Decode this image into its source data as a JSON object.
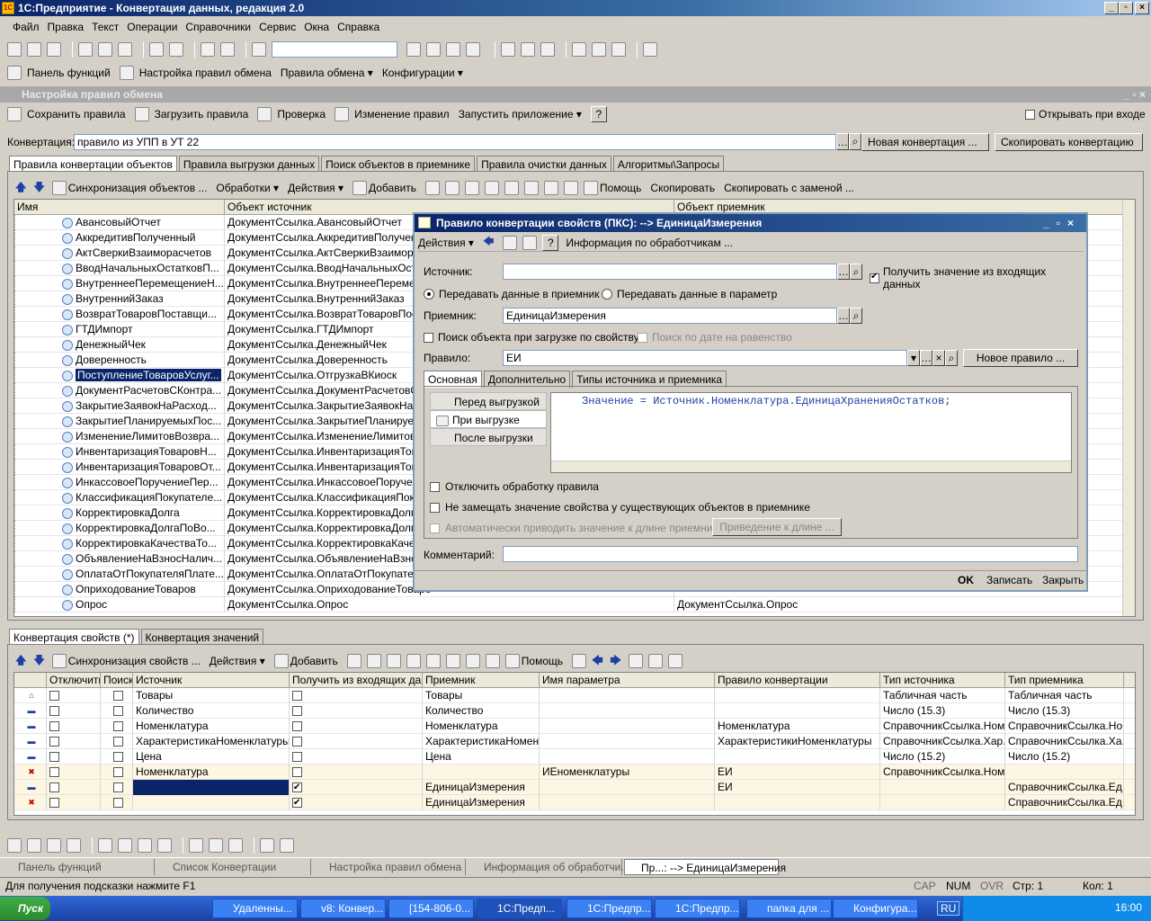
{
  "window": {
    "title": "1С:Предприятие - Конвертация данных, редакция 2.0"
  },
  "menu": [
    "Файл",
    "Правка",
    "Текст",
    "Операции",
    "Справочники",
    "Сервис",
    "Окна",
    "Справка"
  ],
  "panel_toolbar": {
    "functions": "Панель функций",
    "settings": "Настройка правил обмена",
    "rules": "Правила обмена",
    "configs": "Конфигурации"
  },
  "subwindow": {
    "title": "Настройка правил обмена"
  },
  "sub_toolbar": {
    "save": "Сохранить правила",
    "load": "Загрузить правила",
    "check": "Проверка",
    "change": "Изменение правил",
    "run": "Запустить приложение",
    "open_on_start": "Открывать при входе"
  },
  "conversion": {
    "label": "Конвертация:",
    "value": "правило из УПП в УТ 22",
    "new_btn": "Новая конвертация ...",
    "copy_btn": "Скопировать конвертацию"
  },
  "top_tabs": [
    "Правила конвертации объектов",
    "Правила выгрузки данных",
    "Поиск объектов в приемнике",
    "Правила очистки данных",
    "Алгоритмы\\Запросы"
  ],
  "obj_toolbar": {
    "sync": "Синхронизация объектов ...",
    "processing": "Обработки",
    "actions": "Действия",
    "add": "Добавить",
    "help": "Помощь",
    "copy": "Скопировать",
    "copy_replace": "Скопировать с заменой ..."
  },
  "obj_grid": {
    "headers": [
      "Имя",
      "Объект источник",
      "Объект приемник"
    ],
    "rows": [
      [
        "АвансовыйОтчет",
        "ДокументСсылка.АвансовыйОтчет",
        ""
      ],
      [
        "АккредитивПолученный",
        "ДокументСсылка.АккредитивПолученны",
        ""
      ],
      [
        "АктСверкиВзаиморасчетов",
        "ДокументСсылка.АктСверкиВзаиморас",
        ""
      ],
      [
        "ВводНачальныхОстатковП...",
        "ДокументСсылка.ВводНачальныхОстат",
        ""
      ],
      [
        "ВнутреннееПеремещениеН...",
        "ДокументСсылка.ВнутреннееПеремеще",
        ""
      ],
      [
        "ВнутреннийЗаказ",
        "ДокументСсылка.ВнутреннийЗаказ",
        ""
      ],
      [
        "ВозвратТоваровПоставщи...",
        "ДокументСсылка.ВозвратТоваровПоста",
        ""
      ],
      [
        "ГТДИмпорт",
        "ДокументСсылка.ГТДИмпорт",
        ""
      ],
      [
        "ДенежныйЧек",
        "ДокументСсылка.ДенежныйЧек",
        ""
      ],
      [
        "Доверенность",
        "ДокументСсылка.Доверенность",
        ""
      ],
      [
        "ПоступлениеТоваровУслуг...",
        "ДокументСсылка.ОтгрузкаВКиоск",
        ""
      ],
      [
        "ДокументРасчетовСКонтра...",
        "ДокументСсылка.ДокументРасчетовСК",
        ""
      ],
      [
        "ЗакрытиеЗаявокНаРасход...",
        "ДокументСсылка.ЗакрытиеЗаявокНаРа",
        ""
      ],
      [
        "ЗакрытиеПланируемыхПос...",
        "ДокументСсылка.ЗакрытиеПланируемь",
        ""
      ],
      [
        "ИзменениеЛимитовВозвра...",
        "ДокументСсылка.ИзменениеЛимитовВо",
        ""
      ],
      [
        "ИнвентаризацияТоваровН...",
        "ДокументСсылка.ИнвентаризацияТовар",
        ""
      ],
      [
        "ИнвентаризацияТоваровОт...",
        "ДокументСсылка.ИнвентаризацияТовар",
        ""
      ],
      [
        "ИнкассовоеПоручениеПер...",
        "ДокументСсылка.ИнкассовоеПоручение",
        ""
      ],
      [
        "КлассификацияПокупателе...",
        "ДокументСсылка.КлассификацияПокуп",
        ""
      ],
      [
        "КорректировкаДолга",
        "ДокументСсылка.КорректировкаДолга",
        ""
      ],
      [
        "КорректировкаДолгаПоВо...",
        "ДокументСсылка.КорректировкаДолгаГ",
        ""
      ],
      [
        "КорректировкаКачестваТо...",
        "ДокументСсылка.КорректировкаКачест",
        ""
      ],
      [
        "ОбъявлениеНаВзносНалич...",
        "ДокументСсылка.ОбъявлениеНаВзносН",
        ""
      ],
      [
        "ОплатаОтПокупателяПлате...",
        "ДокументСсылка.ОплатаОтПокупателяГ",
        ""
      ],
      [
        "ОприходованиеТоваров",
        "ДокументСсылка.ОприходованиеТоваро",
        ""
      ],
      [
        "Опрос",
        "ДокументСсылка.Опрос",
        "ДокументСсылка.Опрос"
      ]
    ]
  },
  "bottom_tabs": [
    "Конвертация свойств (*)",
    "Конвертация значений"
  ],
  "prop_toolbar": {
    "sync": "Синхронизация свойств ...",
    "actions": "Действия",
    "add": "Добавить",
    "help": "Помощь"
  },
  "prop_grid": {
    "headers": [
      "Отключить",
      "Поиск",
      "Источник",
      "Получить из входящих дан...",
      "Приемник",
      "Имя параметра",
      "Правило конвертации",
      "Тип источника",
      "Тип приемника"
    ],
    "rows": [
      [
        "",
        "",
        "Товары",
        "",
        "Товары",
        "",
        "",
        "Табличная часть",
        "Табличная часть"
      ],
      [
        "",
        "",
        "Количество",
        "",
        "Количество",
        "",
        "",
        "Число (15.3)",
        "Число (15.3)"
      ],
      [
        "",
        "",
        "Номенклатура",
        "",
        "Номенклатура",
        "",
        "Номенклатура",
        "СправочникСсылка.Ном...",
        "СправочникСсылка.Но..."
      ],
      [
        "",
        "",
        "ХарактеристикаНоменклатуры",
        "",
        "ХарактеристикаНомен...",
        "",
        "ХарактеристикиНоменклатуры",
        "СправочникСсылка.Хар...",
        "СправочникСсылка.Ха..."
      ],
      [
        "",
        "",
        "Цена",
        "",
        "Цена",
        "",
        "",
        "Число (15.2)",
        "Число (15.2)"
      ],
      [
        "",
        "",
        "Номенклатура",
        "",
        "",
        "ИЕноменклатуры",
        "ЕИ",
        "СправочникСсылка.Ном...",
        ""
      ],
      [
        "",
        "",
        "",
        "",
        "ЕдиницаИзмерения",
        "",
        "ЕИ",
        "",
        "СправочникСсылка.Ед..."
      ],
      [
        "",
        "",
        "",
        "",
        "ЕдиницаИзмерения",
        "",
        "",
        "",
        "СправочникСсылка.Ед..."
      ]
    ]
  },
  "dialog": {
    "title": "Правило конвертации свойств (ПКС):  --> ЕдиницаИзмерения",
    "actions": "Действия",
    "info": "Информация по обработчикам ...",
    "source_label": "Источник:",
    "get_incoming": "Получить значение из входящих данных",
    "radio_receiver": "Передавать данные в приемник",
    "radio_param": "Передавать данные в параметр",
    "receiver_label": "Приемник:",
    "receiver_value": "ЕдиницаИзмерения",
    "search_by_prop": "Поиск объекта при загрузке по свойству",
    "search_by_date": "Поиск по дате на равенство",
    "rule_label": "Правило:",
    "rule_value": "ЕИ",
    "new_rule": "Новое правило ...",
    "tabs": [
      "Основная",
      "Дополнительно",
      "Типы источника и приемника"
    ],
    "handlers": [
      "Перед выгрузкой",
      "При выгрузке",
      "После выгрузки"
    ],
    "code": "Значение = Источник.Номенклатура.ЕдиницаХраненияОстатков;",
    "disable": "Отключить обработку правила",
    "no_replace": "Не замещать значение свойства у существующих объектов в приемнике",
    "auto_length": "Автоматически приводить значение к длине приемника",
    "to_length": "Приведение к длине ...",
    "comment_label": "Комментарий:",
    "ok": "OK",
    "write": "Записать",
    "close": "Закрыть"
  },
  "window_tabs": [
    "Панель функций",
    "Список Конвертации",
    "Настройка правил обмена",
    "Информация об обработчи...",
    "Пр...: --> ЕдиницаИзмерения"
  ],
  "status": {
    "hint": "Для получения подсказки нажмите F1",
    "cap": "CAP",
    "num": "NUM",
    "ovr": "OVR",
    "line": "Стр: 1",
    "col": "Кол: 1"
  },
  "taskbar": {
    "start": "Пуск",
    "items": [
      "Удаленны...",
      "v8: Конвер...",
      "[154-806-0...",
      "1С:Предп...",
      "1С:Предпр...",
      "1С:Предпр...",
      "папка для ...",
      "Конфигура..."
    ],
    "lang": "RU",
    "clock": "16:00"
  }
}
